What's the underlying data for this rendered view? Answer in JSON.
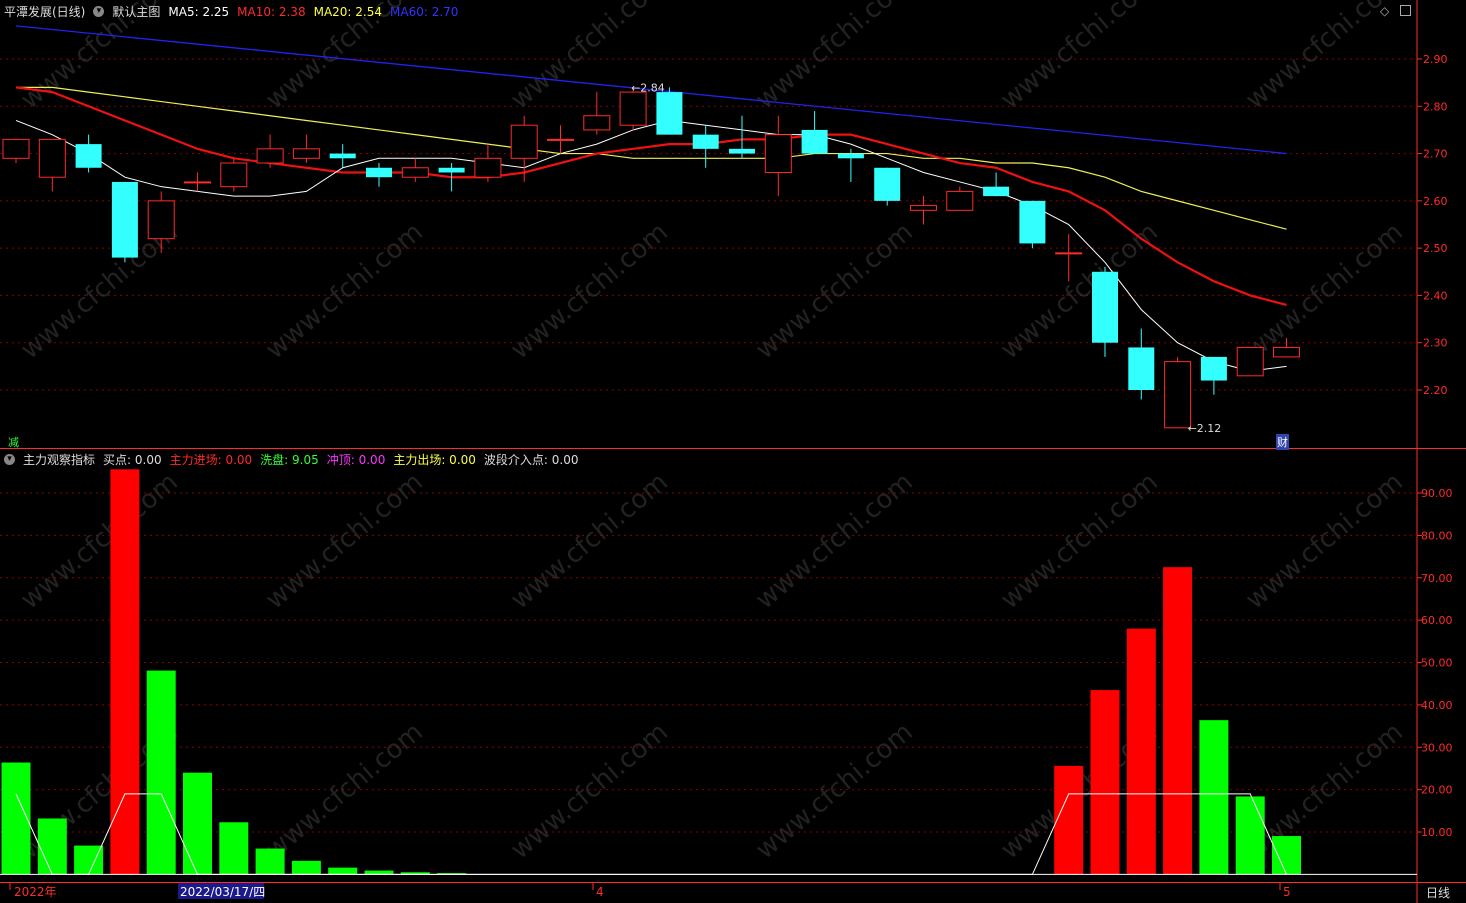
{
  "header": {
    "title": "平潭发展(日线)",
    "main_label": "默认主图",
    "ma": [
      {
        "label": "MA5: 2.25",
        "color": "#ffffff"
      },
      {
        "label": "MA10: 2.38",
        "color": "#ff2a2a"
      },
      {
        "label": "MA20: 2.54",
        "color": "#ffff44"
      },
      {
        "label": "MA60: 2.70",
        "color": "#3333ff"
      }
    ]
  },
  "indicator_header": {
    "name": "主力观察指标",
    "items": [
      {
        "label": "买点: 0.00",
        "color": "#dddddd"
      },
      {
        "label": "主力进场: 0.00",
        "color": "#ff2a2a"
      },
      {
        "label": "洗盘: 9.05",
        "color": "#33ff33"
      },
      {
        "label": "冲顶: 0.00",
        "color": "#ff33ff"
      },
      {
        "label": "主力出场: 0.00",
        "color": "#ffff44"
      },
      {
        "label": "波段介入点: 0.00",
        "color": "#dddddd"
      }
    ]
  },
  "markers": {
    "left_bottom": "减",
    "right_bottom": "财"
  },
  "watermark": "www.cfchi.com",
  "bottom_axis": {
    "labels": [
      "2022年",
      "2022/03/17/四",
      "4",
      "5"
    ],
    "period": "日线"
  },
  "chart_data": [
    {
      "type": "candlestick",
      "title": "平潭发展(日线)",
      "ylim": [
        2.1,
        2.97
      ],
      "yticks": [
        "2.90",
        "2.80",
        "2.70",
        "2.60",
        "2.50",
        "2.40",
        "2.30",
        "2.20"
      ],
      "candles": [
        {
          "o": 2.69,
          "h": 2.72,
          "l": 2.68,
          "c": 2.73
        },
        {
          "o": 2.65,
          "h": 2.73,
          "l": 2.62,
          "c": 2.73
        },
        {
          "o": 2.72,
          "h": 2.74,
          "l": 2.66,
          "c": 2.67
        },
        {
          "o": 2.64,
          "h": 2.64,
          "l": 2.47,
          "c": 2.48
        },
        {
          "o": 2.52,
          "h": 2.62,
          "l": 2.49,
          "c": 2.6
        },
        {
          "o": 2.64,
          "h": 2.66,
          "l": 2.62,
          "c": 2.64
        },
        {
          "o": 2.63,
          "h": 2.69,
          "l": 2.62,
          "c": 2.68
        },
        {
          "o": 2.68,
          "h": 2.74,
          "l": 2.67,
          "c": 2.71
        },
        {
          "o": 2.69,
          "h": 2.74,
          "l": 2.68,
          "c": 2.71
        },
        {
          "o": 2.7,
          "h": 2.72,
          "l": 2.67,
          "c": 2.69
        },
        {
          "o": 2.67,
          "h": 2.68,
          "l": 2.63,
          "c": 2.65
        },
        {
          "o": 2.65,
          "h": 2.69,
          "l": 2.64,
          "c": 2.67
        },
        {
          "o": 2.67,
          "h": 2.68,
          "l": 2.62,
          "c": 2.66
        },
        {
          "o": 2.65,
          "h": 2.72,
          "l": 2.64,
          "c": 2.69
        },
        {
          "o": 2.69,
          "h": 2.78,
          "l": 2.64,
          "c": 2.76
        },
        {
          "o": 2.73,
          "h": 2.76,
          "l": 2.7,
          "c": 2.73
        },
        {
          "o": 2.75,
          "h": 2.83,
          "l": 2.74,
          "c": 2.78
        },
        {
          "o": 2.76,
          "h": 2.84,
          "l": 2.75,
          "c": 2.83
        },
        {
          "o": 2.83,
          "h": 2.84,
          "l": 2.74,
          "c": 2.74
        },
        {
          "o": 2.74,
          "h": 2.76,
          "l": 2.67,
          "c": 2.71
        },
        {
          "o": 2.71,
          "h": 2.78,
          "l": 2.69,
          "c": 2.7
        },
        {
          "o": 2.66,
          "h": 2.78,
          "l": 2.61,
          "c": 2.74
        },
        {
          "o": 2.75,
          "h": 2.79,
          "l": 2.7,
          "c": 2.7
        },
        {
          "o": 2.7,
          "h": 2.71,
          "l": 2.64,
          "c": 2.69
        },
        {
          "o": 2.67,
          "h": 2.67,
          "l": 2.59,
          "c": 2.6
        },
        {
          "o": 2.58,
          "h": 2.61,
          "l": 2.55,
          "c": 2.59
        },
        {
          "o": 2.58,
          "h": 2.63,
          "l": 2.58,
          "c": 2.62
        },
        {
          "o": 2.63,
          "h": 2.66,
          "l": 2.61,
          "c": 2.61
        },
        {
          "o": 2.6,
          "h": 2.6,
          "l": 2.5,
          "c": 2.51
        },
        {
          "o": 2.49,
          "h": 2.53,
          "l": 2.43,
          "c": 2.49
        },
        {
          "o": 2.45,
          "h": 2.46,
          "l": 2.27,
          "c": 2.3
        },
        {
          "o": 2.29,
          "h": 2.33,
          "l": 2.18,
          "c": 2.2
        },
        {
          "o": 2.12,
          "h": 2.27,
          "l": 2.12,
          "c": 2.26
        },
        {
          "o": 2.27,
          "h": 2.27,
          "l": 2.19,
          "c": 2.22
        },
        {
          "o": 2.23,
          "h": 2.29,
          "l": 2.23,
          "c": 2.29
        },
        {
          "o": 2.27,
          "h": 2.31,
          "l": 2.27,
          "c": 2.29
        }
      ],
      "ma5": [
        2.77,
        2.74,
        2.7,
        2.65,
        2.63,
        2.62,
        2.61,
        2.61,
        2.62,
        2.67,
        2.69,
        2.69,
        2.69,
        2.68,
        2.67,
        2.7,
        2.72,
        2.75,
        2.77,
        2.76,
        2.75,
        2.74,
        2.74,
        2.72,
        2.69,
        2.66,
        2.64,
        2.62,
        2.59,
        2.55,
        2.47,
        2.37,
        2.3,
        2.26,
        2.24,
        2.25
      ],
      "ma10": [
        2.84,
        2.83,
        2.8,
        2.77,
        2.74,
        2.71,
        2.69,
        2.68,
        2.67,
        2.66,
        2.66,
        2.66,
        2.65,
        2.65,
        2.66,
        2.68,
        2.7,
        2.71,
        2.72,
        2.72,
        2.73,
        2.73,
        2.74,
        2.74,
        2.72,
        2.7,
        2.68,
        2.67,
        2.64,
        2.62,
        2.58,
        2.52,
        2.47,
        2.43,
        2.4,
        2.38
      ],
      "ma20": [
        2.84,
        2.84,
        2.83,
        2.82,
        2.81,
        2.8,
        2.79,
        2.78,
        2.77,
        2.76,
        2.75,
        2.74,
        2.73,
        2.72,
        2.71,
        2.7,
        2.7,
        2.69,
        2.69,
        2.69,
        2.69,
        2.69,
        2.7,
        2.7,
        2.7,
        2.69,
        2.69,
        2.68,
        2.68,
        2.67,
        2.65,
        2.62,
        2.6,
        2.58,
        2.56,
        2.54
      ],
      "ma60_start": 2.97,
      "ma60_end": 2.7,
      "annotations": [
        "2.84",
        "2.12"
      ]
    },
    {
      "type": "bar",
      "title": "主力观察指标",
      "ylim": [
        0,
        100
      ],
      "yticks": [
        "90.00",
        "80.00",
        "70.00",
        "60.00",
        "50.00",
        "40.00",
        "30.00",
        "20.00",
        "10.00"
      ],
      "series": [
        {
          "name": "主力进场",
          "values": [
            0,
            0,
            0,
            95.6,
            0,
            0,
            0,
            0,
            0,
            0,
            0,
            0,
            0,
            0,
            0,
            0,
            0,
            0,
            0,
            0,
            0,
            0,
            0,
            0,
            0,
            0,
            0,
            0,
            0,
            25.6,
            43.5,
            58.0,
            72.5,
            0,
            0,
            0
          ]
        },
        {
          "name": "洗盘",
          "values": [
            26.4,
            13.2,
            6.8,
            0,
            48.1,
            24.0,
            12.3,
            6.1,
            3.2,
            1.6,
            0.9,
            0.5,
            0.3,
            0,
            0,
            0,
            0,
            0,
            0,
            0,
            0,
            0,
            0,
            0,
            0,
            0,
            0,
            0,
            0,
            0,
            0,
            0,
            0,
            36.4,
            18.4,
            9.05
          ]
        }
      ],
      "line": [
        19,
        0,
        0,
        19,
        19,
        0,
        0,
        0,
        0,
        0,
        0,
        0,
        0,
        0,
        0,
        0,
        0,
        0,
        0,
        0,
        0,
        0,
        0,
        0,
        0,
        0,
        0,
        0,
        0,
        19,
        19,
        19,
        19,
        19,
        19,
        0
      ]
    }
  ]
}
